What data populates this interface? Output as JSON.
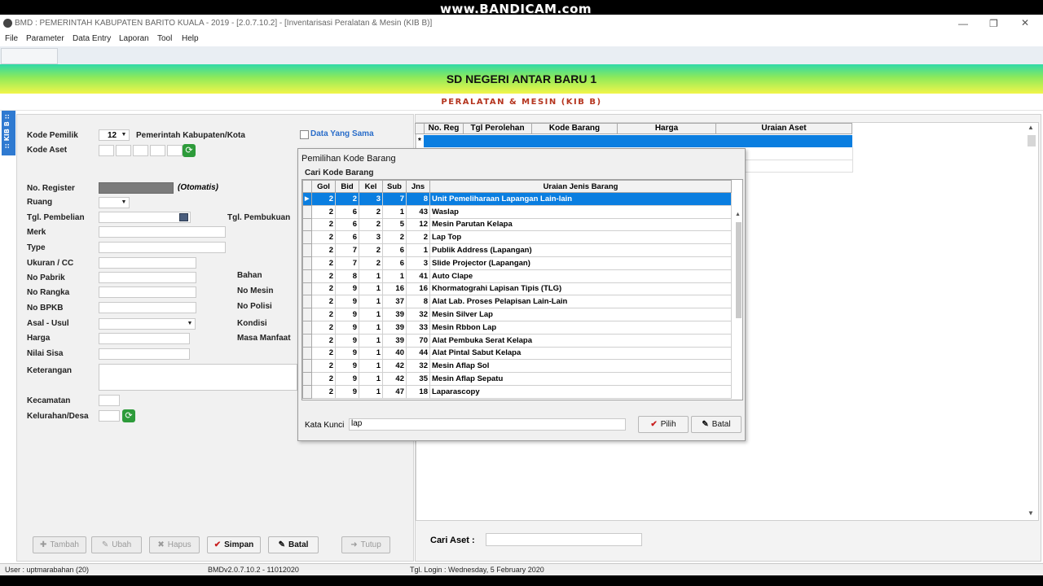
{
  "watermark": "www.BANDICAM.com",
  "window": {
    "title": "BMD : PEMERINTAH KABUPATEN BARITO KUALA - 2019 - [2.0.7.10.2] - [Inventarisasi Peralatan & Mesin (KIB B)]"
  },
  "menu": [
    "File",
    "Parameter",
    "Data Entry",
    "Laporan",
    "Tool",
    "Help"
  ],
  "banner": {
    "school": "SD NEGERI ANTAR BARU 1",
    "subtitle": "PERALATAN & MESIN (KIB B)"
  },
  "sidetab": ":: KIB B ::",
  "form": {
    "kode_pemilik_label": "Kode Pemilik",
    "kode_pemilik_value": "12",
    "kode_pemilik_desc": "Pemerintah Kabupaten/Kota",
    "kode_aset_label": "Kode Aset",
    "data_sama_label": "Data Yang Sama",
    "no_register_label": "No. Register",
    "no_register_note": "(Otomatis)",
    "ruang_label": "Ruang",
    "tgl_pembelian_label": "Tgl. Pembelian",
    "tgl_pembukuan_label": "Tgl. Pembukuan",
    "merk_label": "Merk",
    "type_label": "Type",
    "ukuran_label": "Ukuran / CC",
    "no_pabrik_label": "No Pabrik",
    "bahan_label": "Bahan",
    "no_rangka_label": "No Rangka",
    "no_mesin_label": "No Mesin",
    "no_bpkb_label": "No BPKB",
    "no_polisi_label": "No Polisi",
    "asal_usul_label": "Asal - Usul",
    "kondisi_label": "Kondisi",
    "harga_label": "Harga",
    "masa_manfaat_label": "Masa Manfaat",
    "nilai_sisa_label": "Nilai Sisa",
    "keterangan_label": "Keterangan",
    "kecamatan_label": "Kecamatan",
    "kelurahan_label": "Kelurahan/Desa"
  },
  "buttons": {
    "tambah": "Tambah",
    "ubah": "Ubah",
    "hapus": "Hapus",
    "simpan": "Simpan",
    "batal": "Batal",
    "tutup": "Tutup"
  },
  "grid": {
    "headers": [
      "No. Reg",
      "Tgl Perolehan",
      "Kode Barang",
      "Harga",
      "Uraian Aset"
    ],
    "new_row_marker": "*"
  },
  "cari_aset_label": "Cari Aset :",
  "dialog": {
    "title": "Pemilihan Kode Barang",
    "group": "Cari Kode Barang",
    "headers": [
      "Gol",
      "Bid",
      "Kel",
      "Sub",
      "Jns",
      "Uraian Jenis Barang"
    ],
    "rows": [
      [
        "2",
        "2",
        "3",
        "7",
        "8",
        "Unit Pemeliharaan Lapangan Lain-lain"
      ],
      [
        "2",
        "6",
        "2",
        "1",
        "43",
        "Waslap"
      ],
      [
        "2",
        "6",
        "2",
        "5",
        "12",
        "Mesin Parutan Kelapa"
      ],
      [
        "2",
        "6",
        "3",
        "2",
        "2",
        "Lap Top"
      ],
      [
        "2",
        "7",
        "2",
        "6",
        "1",
        "Publik Address (Lapangan)"
      ],
      [
        "2",
        "7",
        "2",
        "6",
        "3",
        "Slide Projector (Lapangan)"
      ],
      [
        "2",
        "8",
        "1",
        "1",
        "41",
        "Auto Clape"
      ],
      [
        "2",
        "9",
        "1",
        "16",
        "16",
        "Khormatograhi Lapisan Tipis (TLG)"
      ],
      [
        "2",
        "9",
        "1",
        "37",
        "8",
        "Alat Lab. Proses Pelapisan Lain-Lain"
      ],
      [
        "2",
        "9",
        "1",
        "39",
        "32",
        "Mesin Silver Lap"
      ],
      [
        "2",
        "9",
        "1",
        "39",
        "33",
        "Mesin Rbbon Lap"
      ],
      [
        "2",
        "9",
        "1",
        "39",
        "70",
        "Alat Pembuka Serat Kelapa"
      ],
      [
        "2",
        "9",
        "1",
        "40",
        "44",
        "Alat Pintal Sabut Kelapa"
      ],
      [
        "2",
        "9",
        "1",
        "42",
        "32",
        "Mesin Aflap Sol"
      ],
      [
        "2",
        "9",
        "1",
        "42",
        "35",
        "Mesin Aflap Sepatu"
      ],
      [
        "2",
        "9",
        "1",
        "47",
        "18",
        "Laparascopy"
      ]
    ],
    "kata_kunci_label": "Kata Kunci",
    "kata_kunci_value": "lap",
    "pilih": "Pilih",
    "batal": "Batal"
  },
  "status": {
    "user": "User : uptmarabahan (20)",
    "version": "BMDv2.0.7.10.2 - 11012020",
    "login": "Tgl. Login : Wednesday, 5 February 2020"
  },
  "colors": {
    "selection": "#0a7ee0",
    "accent_red": "#b5351f",
    "side_tab": "#2f7ad1"
  }
}
